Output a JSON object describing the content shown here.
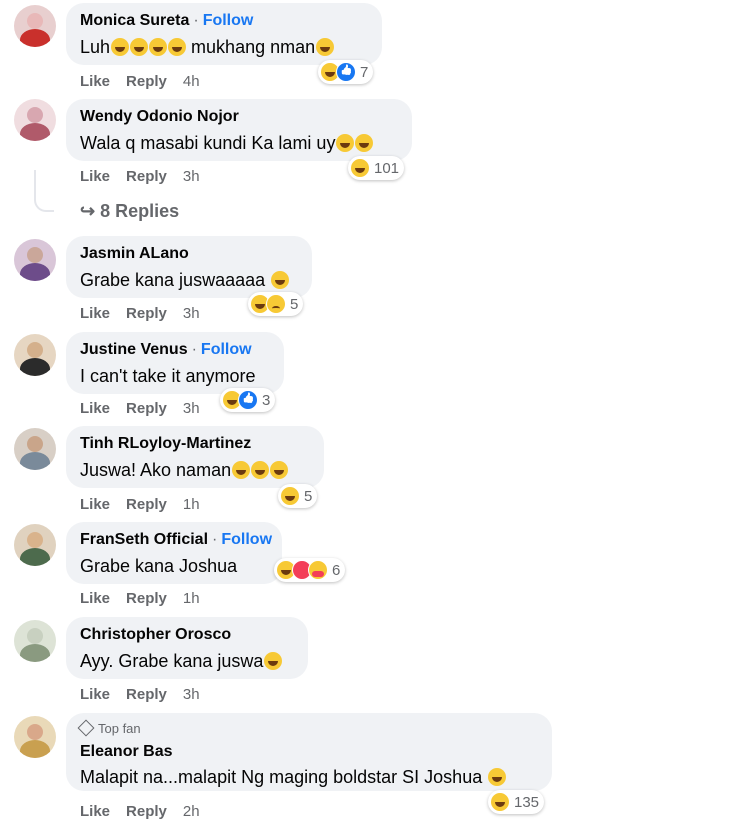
{
  "actions": {
    "like": "Like",
    "reply": "Reply"
  },
  "replies_link": "8 Replies",
  "comments": [
    {
      "name": "Monica Sureta",
      "follow": "Follow",
      "text": "Luh",
      "text_after": " mukhang nman",
      "time": "4h",
      "reaction_count": "7",
      "reactions": [
        "haha",
        "like"
      ],
      "avatar_colors": [
        "#e8b8b8",
        "#c9302c"
      ]
    },
    {
      "name": "Wendy Odonio Nojor",
      "follow": "",
      "text": "Wala q masabi kundi Ka lami uy",
      "time": "3h",
      "reaction_count": "101",
      "reactions": [
        "haha"
      ],
      "avatar_colors": [
        "#d8a7b0",
        "#b05a6a"
      ]
    },
    {
      "name": "Jasmin ALano",
      "follow": "",
      "text": "Grabe kana juswaaaaa",
      "time": "3h",
      "reaction_count": "5",
      "reactions": [
        "haha",
        "sad"
      ],
      "avatar_colors": [
        "#caa79a",
        "#6d4c8a"
      ]
    },
    {
      "name": "Justine Venus",
      "follow": "Follow",
      "text": "I can't take it anymore",
      "time": "3h",
      "reaction_count": "3",
      "reactions": [
        "haha",
        "like"
      ],
      "avatar_colors": [
        "#d4b08c",
        "#2b2b2b"
      ]
    },
    {
      "name": "Tinh RLoyloy-Martinez",
      "follow": "",
      "text": "Juswa! Ako naman",
      "time": "1h",
      "reaction_count": "5",
      "reactions": [
        "haha"
      ],
      "avatar_colors": [
        "#c9a58a",
        "#7a8a9a"
      ]
    },
    {
      "name": "FranSeth Official",
      "follow": "Follow",
      "text": "Grabe kana Joshua",
      "time": "1h",
      "reaction_count": "6",
      "reactions": [
        "haha",
        "love",
        "care"
      ],
      "avatar_colors": [
        "#d9b38c",
        "#4d6b4d"
      ]
    },
    {
      "name": "Christopher Orosco",
      "follow": "",
      "text": "Ayy. Grabe kana juswa",
      "time": "3h",
      "reaction_count": "",
      "reactions": [],
      "avatar_colors": [
        "#c8d0c0",
        "#8a9a80"
      ]
    },
    {
      "name": "Eleanor Bas",
      "follow": "",
      "badge": "Top fan",
      "text": "Malapit na...malapit Ng maging boldstar SI Joshua",
      "time": "2h",
      "reaction_count": "135",
      "reactions": [
        "haha"
      ],
      "avatar_colors": [
        "#d9a88a",
        "#c9a050"
      ]
    }
  ]
}
